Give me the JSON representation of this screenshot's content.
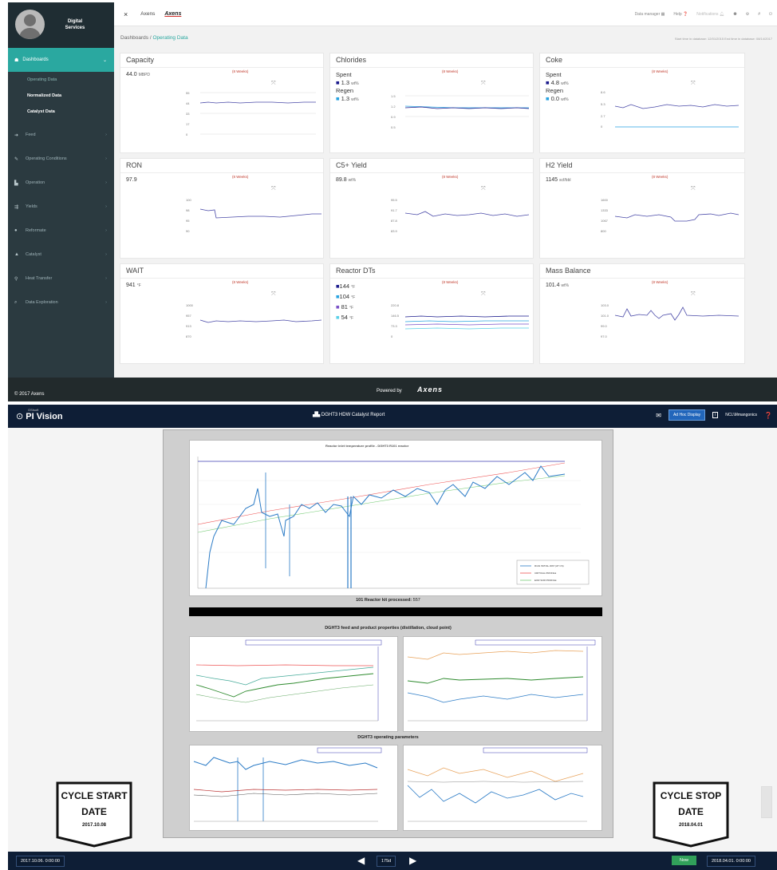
{
  "dashboard": {
    "brand": "Digital\nServices",
    "sidebar": {
      "active": "Dashboards",
      "subitems": [
        "Operating Data",
        "Normalized Data",
        "Catalyst Data"
      ],
      "items": [
        {
          "label": "Feed",
          "icon": "feed-icon"
        },
        {
          "label": "Operating Conditions",
          "icon": "wrench-icon"
        },
        {
          "label": "Operation",
          "icon": "factory-icon"
        },
        {
          "label": "Yields",
          "icon": "yields-icon"
        },
        {
          "label": "Reformate",
          "icon": "drop-icon"
        },
        {
          "label": "Catalyst",
          "icon": "flask-icon"
        },
        {
          "label": "Heat Transfer",
          "icon": "thermometer-icon"
        },
        {
          "label": "Data Exploration",
          "icon": "search-icon"
        }
      ]
    },
    "topbar": {
      "close": "×",
      "tab": "Axens",
      "logo": "Axens",
      "data_manager": "Data manager",
      "help": "Help",
      "notifications": "Notifications"
    },
    "breadcrumb": {
      "root": "Dashboards",
      "sep": "/",
      "current": "Operating Data"
    },
    "db_times": "Start time in database: 12/01/2015    End time in database: 08/14/2017",
    "weeks_label": "(8 Weeks)",
    "cards": {
      "capacity": {
        "title": "Capacity",
        "value": "44.0",
        "unit": "MBPD",
        "ticks": [
          "55",
          "44",
          "33",
          "17",
          "0"
        ]
      },
      "chlorides": {
        "title": "Chlorides",
        "spent": "Spent",
        "spent_val": "1.3",
        "regen": "Regen",
        "regen_val": "1.3",
        "unit": "wt%",
        "ticks": [
          "1.5",
          "1.2",
          "0.9",
          "0.5"
        ]
      },
      "coke": {
        "title": "Coke",
        "spent": "Spent",
        "spent_val": "4.8",
        "regen": "Regen",
        "regen_val": "0.0",
        "unit": "wt%",
        "ticks": [
          "8.6",
          "5.3",
          "2.7",
          "0"
        ]
      },
      "ron": {
        "title": "RON",
        "value": "97.9",
        "unit": "",
        "ticks": [
          "100",
          "98",
          "95",
          "90"
        ]
      },
      "c5": {
        "title": "C5+ Yield",
        "value": "89.8",
        "unit": "wt%",
        "ticks": [
          "95.5",
          "91.7",
          "87.8",
          "83.9"
        ]
      },
      "h2": {
        "title": "H2 Yield",
        "value": "1145",
        "unit": "scf/bbl",
        "ticks": [
          "1600",
          "1333",
          "1067",
          "800"
        ]
      },
      "wait": {
        "title": "WAIT",
        "value": "941",
        "unit": "°F",
        "ticks": [
          "1000",
          "957",
          "913",
          "870"
        ]
      },
      "dts": {
        "title": "Reactor DTs",
        "values": [
          "144",
          "104",
          "81",
          "54"
        ],
        "unit": "°F",
        "colors": [
          "#1a1a8c",
          "#29a3e0",
          "#7b52c7",
          "#5ad0e8"
        ],
        "ticks": [
          "220.8",
          "146.5",
          "73.3",
          "0"
        ]
      },
      "mass": {
        "title": "Mass Balance",
        "value": "101.4",
        "unit": "wt%",
        "ticks": [
          "103.0",
          "101.0",
          "99.0",
          "97.0"
        ]
      }
    },
    "footer": {
      "copyright": "© 2017 Axens",
      "powered": "Powered by",
      "logo": "Axens"
    }
  },
  "pivision": {
    "logo": "PI Vision",
    "logo_small": "OSIsoft",
    "title": "DGHT3 HDW Catalyst Report",
    "adhoc": "Ad Hoc Display",
    "user": "NCL\\Mmangonics",
    "chart_title": "Reactor inlet temperature profile - DGHT3 R101 reactor",
    "legend": [
      "R101 INITIAL WAT (AT CS)",
      "CRITICAL PROFILE",
      "EOR SOR PROFILE"
    ],
    "kit_label": "101 Reactor kit processed:",
    "kit_value": "557",
    "section2": "DGHT3 feed and product properties (distillation, cloud point)",
    "section3": "DGHT3 operating parameters",
    "cycle_start": "CYCLE START",
    "cycle_start_date_label": "DATE",
    "cycle_start_date": "2017.10.08",
    "cycle_stop": "CYCLE STOP",
    "cycle_stop_date_label": "DATE",
    "cycle_stop_date": "2018.04.01",
    "start_time": "2017.10.06. 0:00:00",
    "end_time": "2018.04.01. 0:00:00",
    "duration": "175d",
    "now": "Now"
  }
}
